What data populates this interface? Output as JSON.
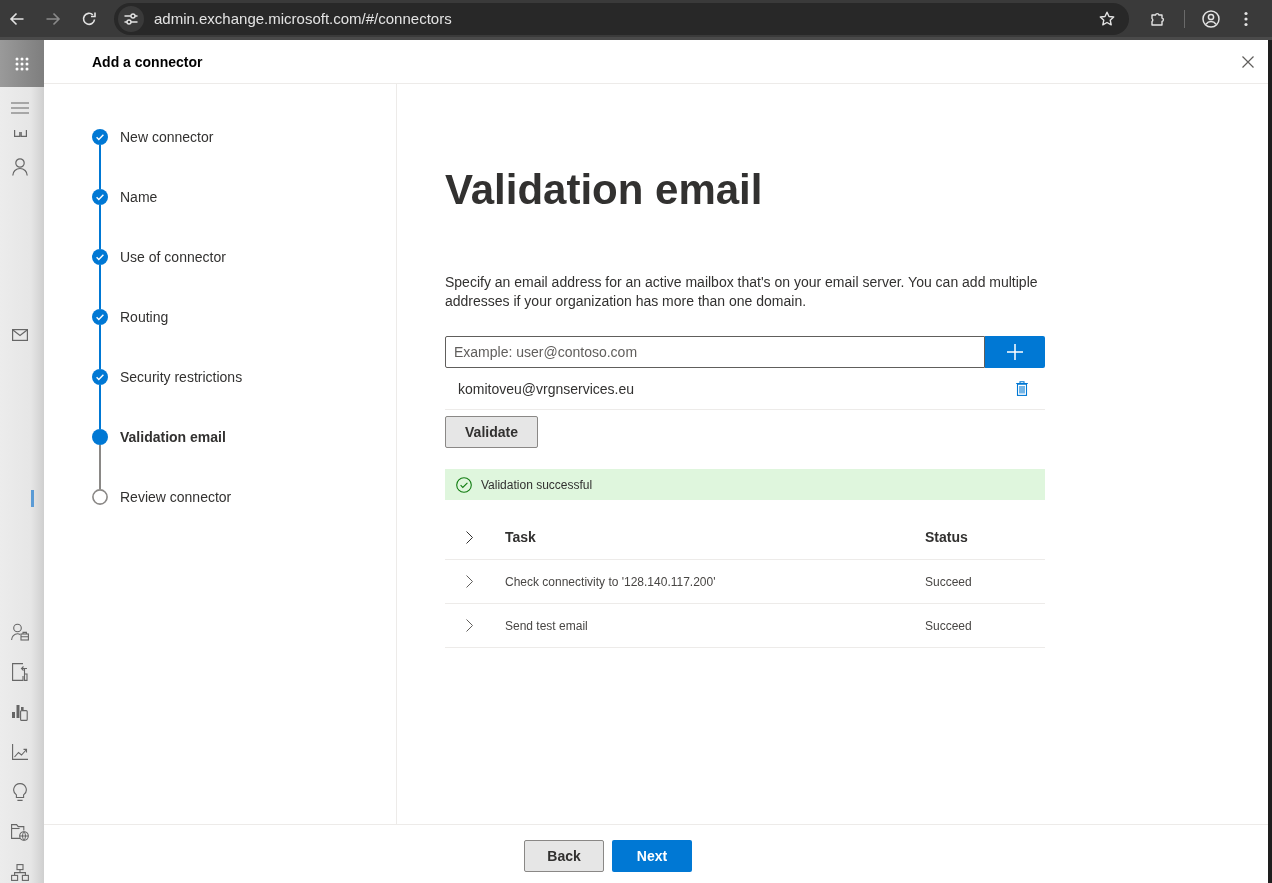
{
  "browser": {
    "nav_buttons": [
      {
        "kind": "back",
        "disabled": false
      },
      {
        "kind": "forward",
        "disabled": true
      },
      {
        "kind": "reload",
        "disabled": false
      }
    ],
    "url": "admin.exchange.microsoft.com/#/connectors"
  },
  "nav_rail": {
    "items": [
      {
        "kind": "menu",
        "selected": false
      },
      {
        "kind": "apps",
        "selected": false
      },
      {
        "kind": "person",
        "selected": false
      },
      {
        "kind": "mail",
        "selected": false
      },
      {
        "kind": "covered",
        "selected": true
      },
      {
        "kind": "people-work",
        "selected": false
      },
      {
        "kind": "sign-in",
        "selected": false
      },
      {
        "kind": "reports-mobile",
        "selected": false
      },
      {
        "kind": "line-chart",
        "selected": false
      },
      {
        "kind": "lightbulb",
        "selected": false
      },
      {
        "kind": "folder-globe",
        "selected": false
      },
      {
        "kind": "org-chart",
        "selected": false
      }
    ]
  },
  "panel": {
    "title": "Add a connector"
  },
  "steps": [
    {
      "label": "New connector",
      "done": true,
      "selected": false
    },
    {
      "label": "Name",
      "done": true,
      "selected": false
    },
    {
      "label": "Use of connector",
      "done": true,
      "selected": false
    },
    {
      "label": "Routing",
      "done": true,
      "selected": false
    },
    {
      "label": "Security restrictions",
      "done": true,
      "selected": false
    },
    {
      "label": "Validation email",
      "done": false,
      "selected": true
    },
    {
      "label": "Review connector",
      "done": false,
      "selected": false
    }
  ],
  "content": {
    "heading": "Validation email",
    "description": "Specify an email address for an active mailbox that's on your email server. You can add multiple addresses if your organization has more than one domain.",
    "email_input": {
      "placeholder": "Example: user@contoso.com"
    },
    "emails": [
      "komitoveu@vrgnservices.eu"
    ],
    "validate_button": "Validate",
    "message": {
      "kind": "success",
      "text": "Validation successful"
    },
    "table": {
      "columns": [
        "Task",
        "Status"
      ],
      "rows": [
        {
          "task": "Check connectivity to '128.140.117.200'",
          "status": "Succeed",
          "expanded": false
        },
        {
          "task": "Send test email",
          "status": "Succeed",
          "expanded": false
        }
      ]
    }
  },
  "footer": {
    "buttons": [
      {
        "label": "Back",
        "kind": "secondary"
      },
      {
        "label": "Next",
        "kind": "primary"
      }
    ]
  }
}
